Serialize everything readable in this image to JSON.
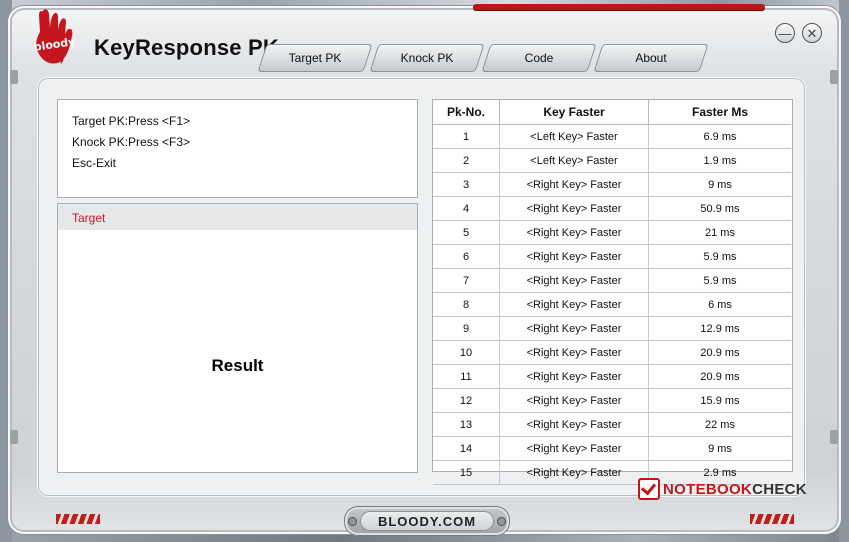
{
  "app": {
    "title": "KeyResponse PK",
    "logo_text": "bloody"
  },
  "tabs": [
    {
      "label": "Target PK"
    },
    {
      "label": "Knock PK"
    },
    {
      "label": "Code"
    },
    {
      "label": "About"
    }
  ],
  "info": {
    "lines": [
      "Target PK:Press <F1>",
      "Knock PK:Press <F3>",
      "Esc-Exit"
    ]
  },
  "result": {
    "header": "Target",
    "label": "Result"
  },
  "table": {
    "headers": [
      "Pk-No.",
      "Key Faster",
      "Faster Ms"
    ],
    "rows": [
      [
        "1",
        "<Left Key> Faster",
        "6.9 ms"
      ],
      [
        "2",
        "<Left Key> Faster",
        "1.9 ms"
      ],
      [
        "3",
        "<Right Key> Faster",
        "9 ms"
      ],
      [
        "4",
        "<Right Key> Faster",
        "50.9 ms"
      ],
      [
        "5",
        "<Right Key> Faster",
        "21 ms"
      ],
      [
        "6",
        "<Right Key> Faster",
        "5.9 ms"
      ],
      [
        "7",
        "<Right Key> Faster",
        "5.9 ms"
      ],
      [
        "8",
        "<Right Key> Faster",
        "6 ms"
      ],
      [
        "9",
        "<Right Key> Faster",
        "12.9 ms"
      ],
      [
        "10",
        "<Right Key> Faster",
        "20.9 ms"
      ],
      [
        "11",
        "<Right Key> Faster",
        "20.9 ms"
      ],
      [
        "12",
        "<Right Key> Faster",
        "15.9 ms"
      ],
      [
        "13",
        "<Right Key> Faster",
        "22 ms"
      ],
      [
        "14",
        "<Right Key> Faster",
        "9 ms"
      ],
      [
        "15",
        "<Right Key> Faster",
        "2.9 ms"
      ]
    ]
  },
  "footer": {
    "site": "BLOODY.COM",
    "watermark_a": "NOTEBOOK",
    "watermark_b": "CHECK"
  },
  "icons": {
    "minimize": "minimize-icon",
    "close": "close-icon"
  },
  "colors": {
    "accent_red": "#c01818",
    "result_header_text": "#d11c1c"
  }
}
